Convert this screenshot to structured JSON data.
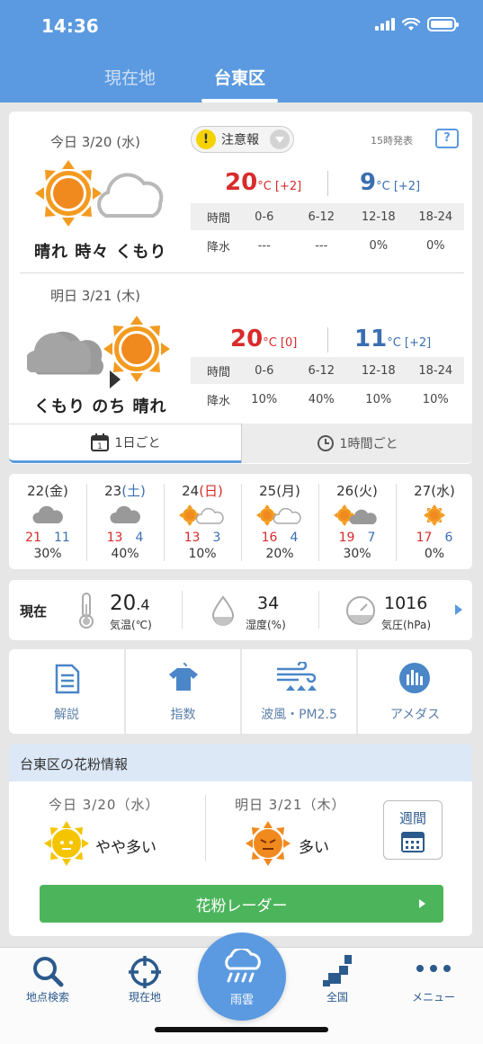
{
  "status": {
    "time": "14:36"
  },
  "location_tabs": [
    {
      "label": "現在地"
    },
    {
      "label": "台東区"
    }
  ],
  "forecast": {
    "warning_label": "注意報",
    "issued": "15時発表",
    "help_glyph": "?",
    "today": {
      "date": "今日 3/20 (水)",
      "weather": "晴れ 時々 くもり",
      "high": "20",
      "high_diff": "[+2]",
      "low": "9",
      "low_diff": "[+2]",
      "unit": "°C",
      "periods_label": "時間",
      "periods": [
        "0-6",
        "6-12",
        "12-18",
        "18-24"
      ],
      "precip_label": "降水",
      "precip": [
        "---",
        "---",
        "0%",
        "0%"
      ]
    },
    "tomorrow": {
      "date": "明日 3/21 (木)",
      "weather": "くもり のち 晴れ",
      "high": "20",
      "high_diff": "[0]",
      "low": "11",
      "low_diff": "[+2]",
      "unit": "°C",
      "periods_label": "時間",
      "periods": [
        "0-6",
        "6-12",
        "12-18",
        "18-24"
      ],
      "precip_label": "降水",
      "precip": [
        "10%",
        "40%",
        "10%",
        "10%"
      ]
    },
    "view_tabs": [
      {
        "label": "1日ごと"
      },
      {
        "label": "1時間ごと"
      }
    ],
    "calendar_glyph": "1"
  },
  "weekly": [
    {
      "day": "22",
      "dow": "(金)",
      "dow_type": "weekday",
      "icon": "cloud-icon",
      "high": "21",
      "low": "11",
      "pop": "30%"
    },
    {
      "day": "23",
      "dow": "(土)",
      "dow_type": "sat",
      "icon": "cloud-icon",
      "high": "13",
      "low": "4",
      "pop": "40%"
    },
    {
      "day": "24",
      "dow": "(日)",
      "dow_type": "sun",
      "icon": "sun-cloud-icon",
      "high": "13",
      "low": "3",
      "pop": "10%"
    },
    {
      "day": "25",
      "dow": "(月)",
      "dow_type": "weekday",
      "icon": "sun-cloud-icon",
      "high": "16",
      "low": "4",
      "pop": "20%"
    },
    {
      "day": "26",
      "dow": "(火)",
      "dow_type": "weekday",
      "icon": "sun-darkcloud-icon",
      "high": "19",
      "low": "7",
      "pop": "30%"
    },
    {
      "day": "27",
      "dow": "(水)",
      "dow_type": "weekday",
      "icon": "sun-icon",
      "high": "17",
      "low": "6",
      "pop": "0%"
    }
  ],
  "current": {
    "label": "現在",
    "temp_int": "20",
    "temp_dec": ".4",
    "temp_label": "気温(℃)",
    "humidity": "34",
    "humidity_label": "湿度(%)",
    "pressure": "1016",
    "pressure_label": "気圧(hPa)"
  },
  "menu": [
    {
      "label": "解説",
      "icon": "document-icon"
    },
    {
      "label": "指数",
      "icon": "shirt-icon"
    },
    {
      "label": "波風・PM2.5",
      "icon": "wind-wave-icon"
    },
    {
      "label": "アメダス",
      "icon": "amedas-icon"
    }
  ],
  "pollen": {
    "title": "台東区の花粉情報",
    "today_date": "今日 3/20（水）",
    "today_level": "やや多い",
    "tomorrow_date": "明日 3/21（木）",
    "tomorrow_level": "多い",
    "weekly_label": "週間",
    "radar_label": "花粉レーダー"
  },
  "bottom_nav": {
    "search": "地点検索",
    "current": "現在地",
    "rain": "雨雲",
    "national": "全国",
    "menu": "メニュー"
  },
  "colors": {
    "accent": "#5b9ae0",
    "high_temp": "#d92b2b",
    "low_temp": "#3a6fb0",
    "radar": "#4cb55c"
  }
}
